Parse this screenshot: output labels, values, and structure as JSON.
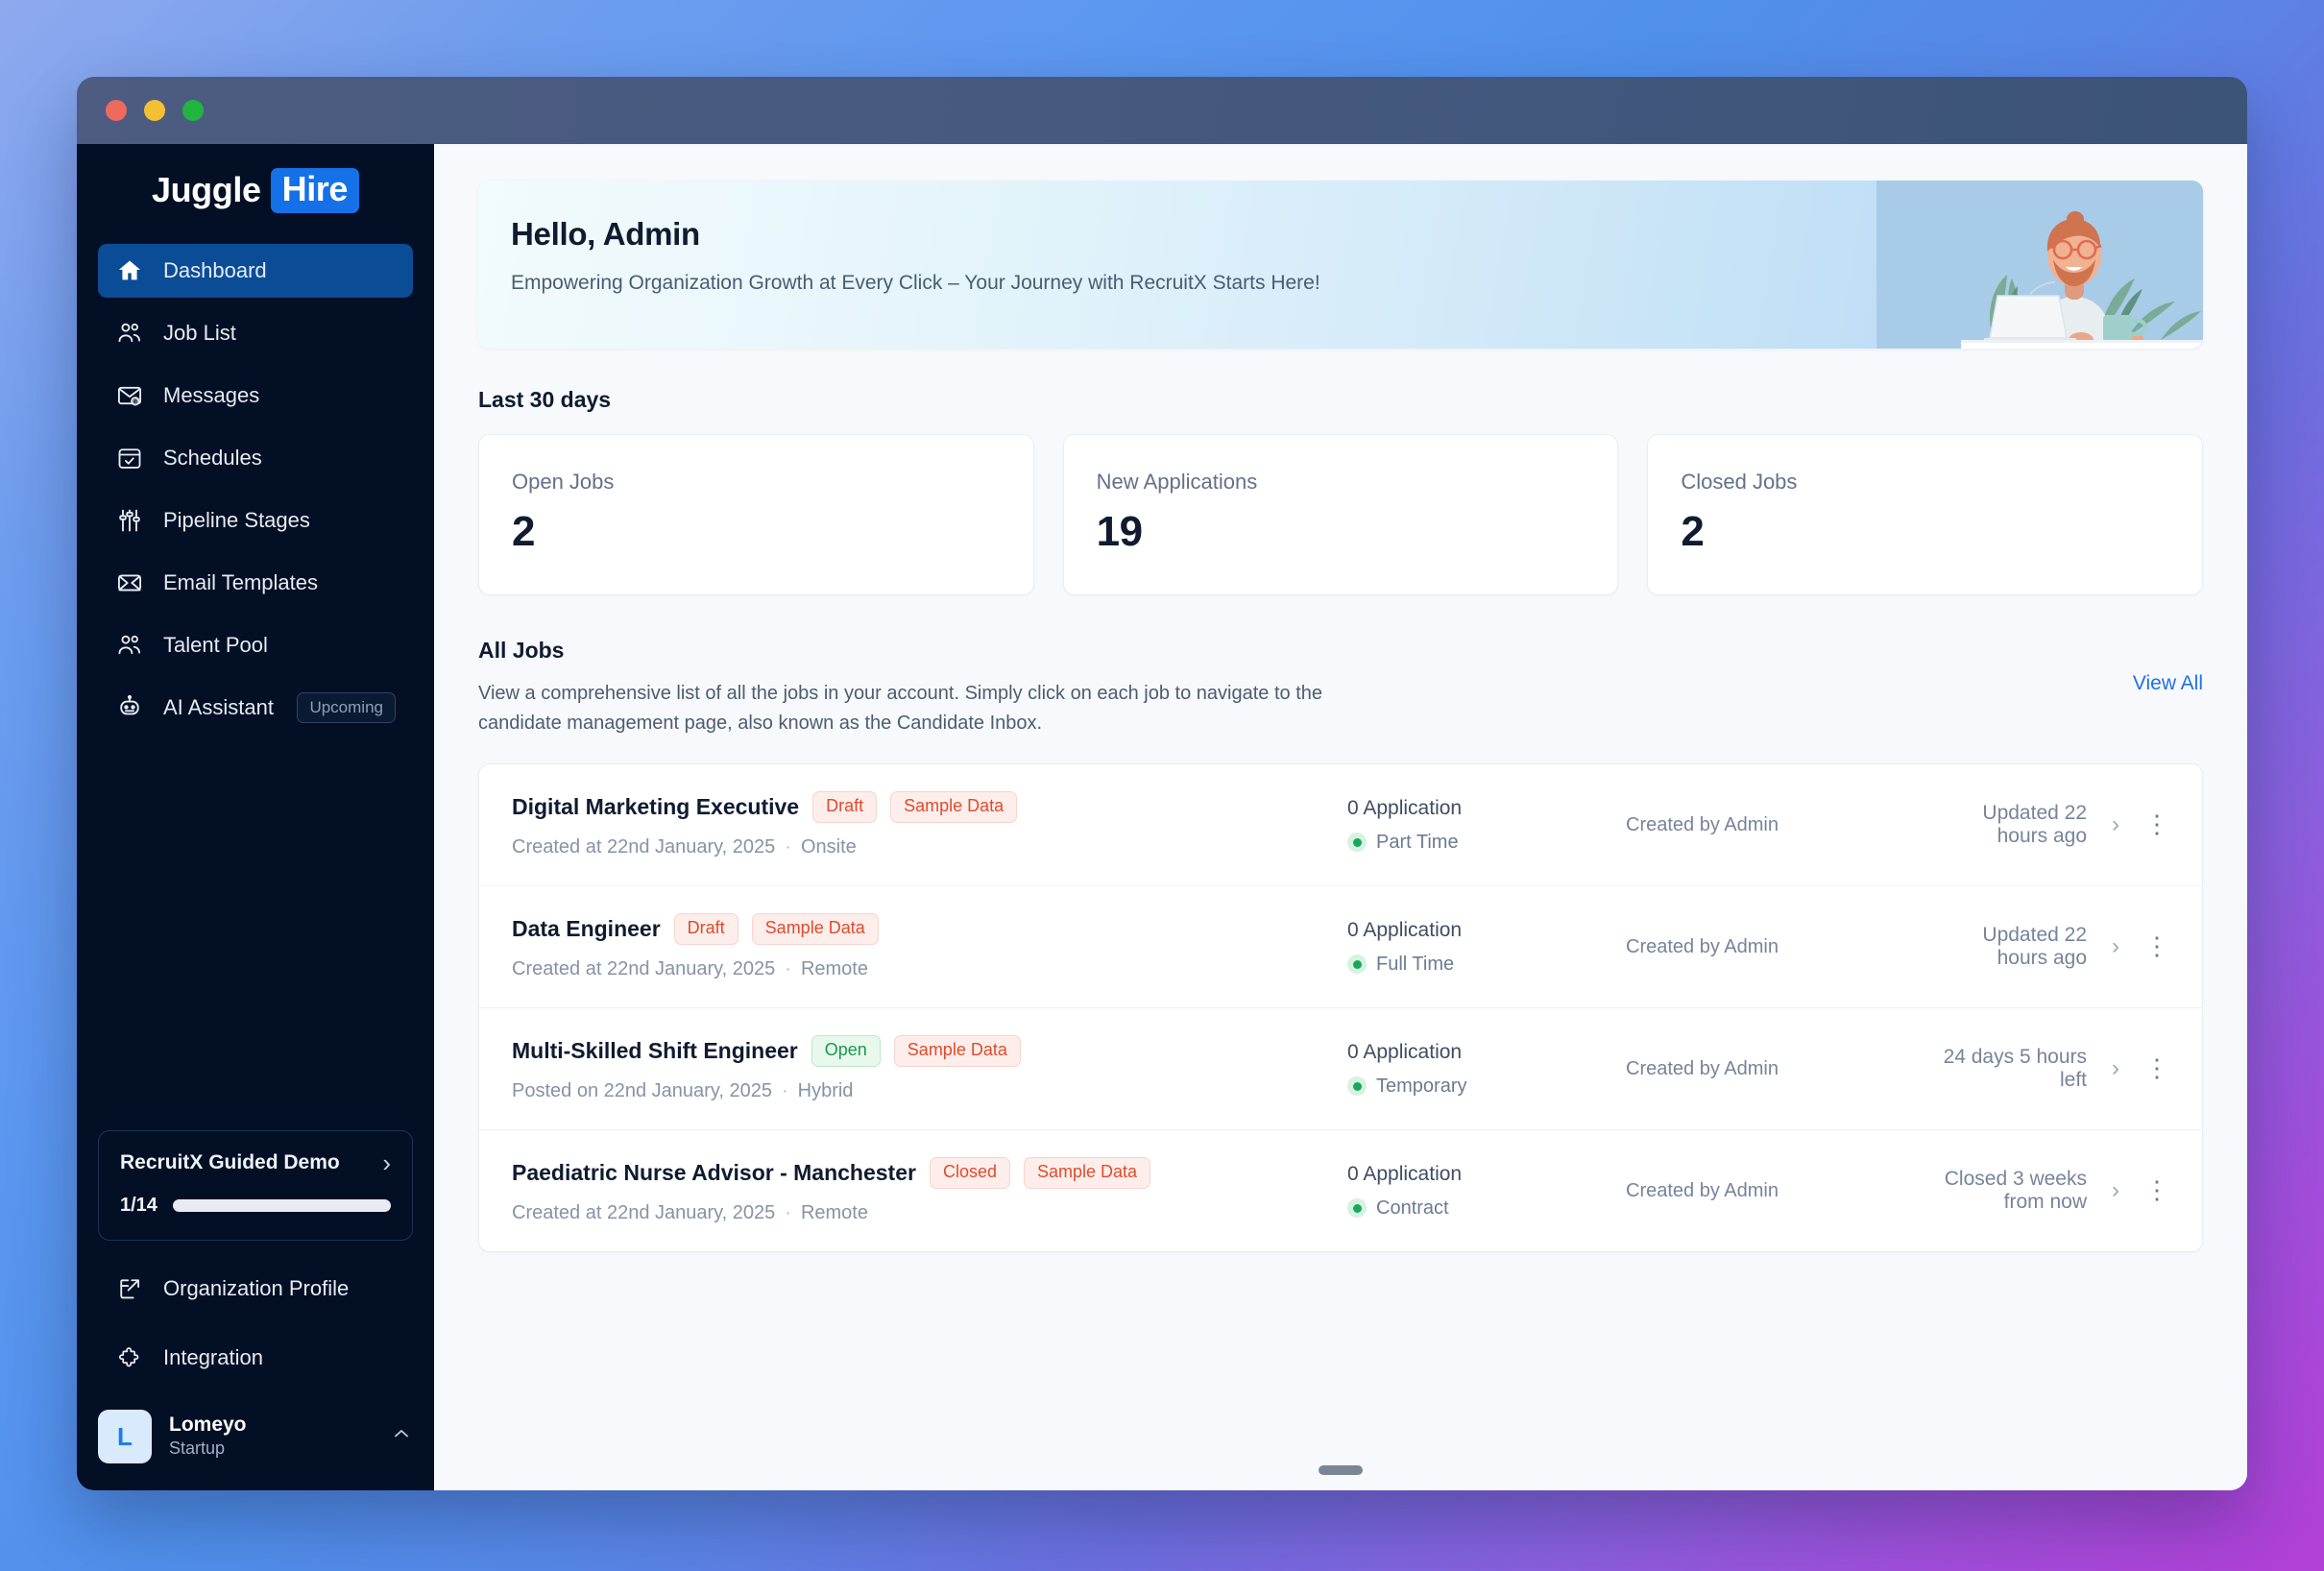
{
  "window": {
    "traffic_lights": [
      "close",
      "minimize",
      "zoom"
    ]
  },
  "sidebar": {
    "logo": {
      "word1": "Juggle",
      "word2": "Hire"
    },
    "items": [
      {
        "label": "Dashboard",
        "icon": "home-icon",
        "active": true
      },
      {
        "label": "Job List",
        "icon": "users-icon",
        "active": false
      },
      {
        "label": "Messages",
        "icon": "mail-at-icon",
        "active": false
      },
      {
        "label": "Schedules",
        "icon": "calendar-check-icon",
        "active": false
      },
      {
        "label": "Pipeline Stages",
        "icon": "sliders-icon",
        "active": false
      },
      {
        "label": "Email Templates",
        "icon": "envelope-open-icon",
        "active": false
      },
      {
        "label": "Talent Pool",
        "icon": "users-icon",
        "active": false
      },
      {
        "label": "AI Assistant",
        "icon": "robot-icon",
        "active": false,
        "pill": "Upcoming"
      }
    ],
    "demo": {
      "title": "RecruitX Guided Demo",
      "progress_label": "1/14",
      "progress_percent": 7,
      "chevron": "chevron-right-icon"
    },
    "bottom_items": [
      {
        "label": "Organization Profile",
        "icon": "external-link-icon"
      },
      {
        "label": "Integration",
        "icon": "puzzle-icon"
      }
    ],
    "user": {
      "initial": "L",
      "name": "Lomeyo",
      "plan": "Startup",
      "caret": "chevron-up-icon"
    }
  },
  "main": {
    "hero": {
      "title": "Hello, Admin",
      "subtitle": "Empowering Organization Growth at Every Click – Your Journey with RecruitX Starts Here!",
      "illustration": "person-at-laptop-with-plants-illustration"
    },
    "stats_section_label": "Last 30 days",
    "stats": [
      {
        "label": "Open Jobs",
        "value": "2"
      },
      {
        "label": "New Applications",
        "value": "19"
      },
      {
        "label": "Closed Jobs",
        "value": "2"
      }
    ],
    "jobs": {
      "title": "All Jobs",
      "description": "View a comprehensive list of all the jobs in your account. Simply click on each job to navigate to the candidate management page, also known as the Candidate Inbox.",
      "view_all_label": "View All",
      "rows": [
        {
          "title": "Digital Marketing Executive",
          "status_badge": "Draft",
          "status_tone": "red",
          "sample_badge": "Sample Data",
          "meta_date": "Created at 22nd January, 2025",
          "meta_mode": "Onsite",
          "applications": "0 Application",
          "employment_type": "Part Time",
          "creator": "Created by Admin",
          "time_label": "Updated 22 hours ago"
        },
        {
          "title": "Data Engineer",
          "status_badge": "Draft",
          "status_tone": "red",
          "sample_badge": "Sample Data",
          "meta_date": "Created at 22nd January, 2025",
          "meta_mode": "Remote",
          "applications": "0 Application",
          "employment_type": "Full Time",
          "creator": "Created by Admin",
          "time_label": "Updated 22 hours ago"
        },
        {
          "title": "Multi-Skilled Shift Engineer",
          "status_badge": "Open",
          "status_tone": "green",
          "sample_badge": "Sample Data",
          "meta_date": "Posted on 22nd January, 2025",
          "meta_mode": "Hybrid",
          "applications": "0 Application",
          "employment_type": "Temporary",
          "creator": "Created by Admin",
          "time_label": "24 days 5 hours left"
        },
        {
          "title": "Paediatric Nurse Advisor - Manchester",
          "status_badge": "Closed",
          "status_tone": "red",
          "sample_badge": "Sample Data",
          "meta_date": "Created at 22nd January, 2025",
          "meta_mode": "Remote",
          "applications": "0 Application",
          "employment_type": "Contract",
          "creator": "Created by Admin",
          "time_label": "Closed 3 weeks from now"
        }
      ]
    }
  },
  "colors": {
    "sidebar_bg": "#030f24",
    "sidebar_active": "#0b4c96",
    "brand_blue": "#1471e8",
    "link_blue": "#2170e8",
    "badge_red_text": "#e24a2b",
    "badge_green_text": "#17994a",
    "status_dot_green": "#17a95a",
    "progress_green": "#22b04f"
  }
}
